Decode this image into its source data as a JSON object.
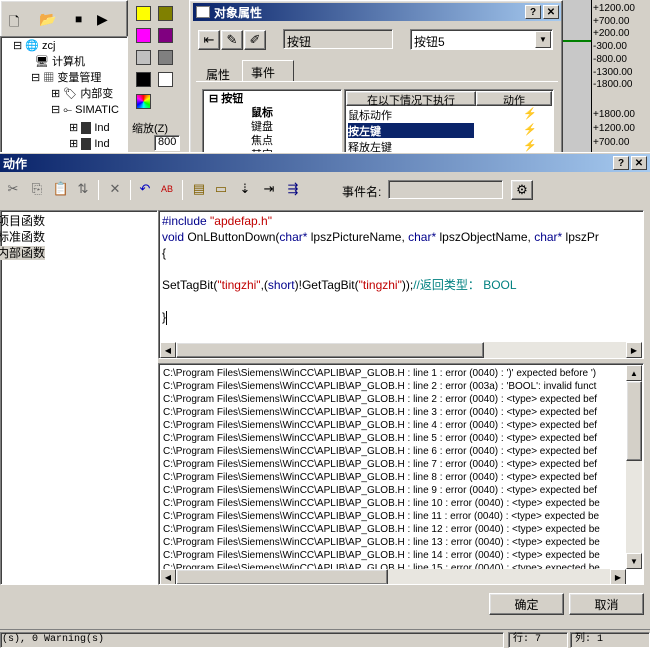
{
  "left_panel": {
    "tree_root": "zcj",
    "tree_items": [
      "计算机",
      "变量管理",
      "内部变",
      "SIMATIC",
      "Ind",
      "Ind"
    ]
  },
  "zoom": {
    "label": "缩放(Z)",
    "value": "800"
  },
  "object_props": {
    "title": "对象属性",
    "object_type": "按钮",
    "object_name": "按钮5",
    "tabs": [
      "属性",
      "事件"
    ],
    "tree": [
      "按钮",
      "鼠标",
      "键盘",
      "焦点",
      "其它"
    ],
    "table_headers": [
      "在以下情况下执行",
      "动作"
    ],
    "rows": [
      "鼠标动作",
      "按左键",
      "释放左键"
    ]
  },
  "right_scale": {
    "top": [
      "+1200.00",
      "+700.00",
      "+200.00",
      "-300.00",
      "-800.00",
      "-1300.00",
      "-1800.00"
    ],
    "bottom": [
      "+1800.00",
      "+1200.00",
      "+700.00"
    ]
  },
  "action_dialog": {
    "title": "动作",
    "event_name_label": "事件名:",
    "event_name_value": "",
    "functions": [
      "项目函数",
      "标准函数",
      "内部函数"
    ],
    "code": {
      "line1_include": "#include",
      "line1_file": "\"apdefap.h\"",
      "line2_void": "void",
      "line2_fn": " OnLButtonDown(",
      "line2_char1": "char*",
      "line2_p1": " lpszPictureName, ",
      "line2_char2": "char*",
      "line2_p2": " lpszObjectName, ",
      "line2_char3": "char*",
      "line2_p3": " lpszPr",
      "line3": "{",
      "line5_a": "SetTagBit(",
      "line5_s1": "\"tingzhi\"",
      "line5_b": ",(",
      "line5_short": "short",
      "line5_c": ")!GetTagBit(",
      "line5_s2": "\"tingzhi\"",
      "line5_d": "));",
      "line5_comment": "//返回类型： BOOL",
      "line7": "}"
    },
    "output": [
      "C:\\Program Files\\Siemens\\WinCC\\APLIB\\AP_GLOB.H : line 1 : error (0040) : ')' expected before ')",
      "C:\\Program Files\\Siemens\\WinCC\\APLIB\\AP_GLOB.H : line 2 : error (003a) : 'BOOL': invalid funct",
      "C:\\Program Files\\Siemens\\WinCC\\APLIB\\AP_GLOB.H : line 2 : error (0040) : <type> expected bef",
      "C:\\Program Files\\Siemens\\WinCC\\APLIB\\AP_GLOB.H : line 3 : error (0040) : <type> expected bef",
      "C:\\Program Files\\Siemens\\WinCC\\APLIB\\AP_GLOB.H : line 4 : error (0040) : <type> expected bef",
      "C:\\Program Files\\Siemens\\WinCC\\APLIB\\AP_GLOB.H : line 5 : error (0040) : <type> expected bef",
      "C:\\Program Files\\Siemens\\WinCC\\APLIB\\AP_GLOB.H : line 6 : error (0040) : <type> expected bef",
      "C:\\Program Files\\Siemens\\WinCC\\APLIB\\AP_GLOB.H : line 7 : error (0040) : <type> expected bef",
      "C:\\Program Files\\Siemens\\WinCC\\APLIB\\AP_GLOB.H : line 8 : error (0040) : <type> expected bef",
      "C:\\Program Files\\Siemens\\WinCC\\APLIB\\AP_GLOB.H : line 9 : error (0040) : <type> expected bef",
      "C:\\Program Files\\Siemens\\WinCC\\APLIB\\AP_GLOB.H : line 10 : error (0040) : <type> expected be",
      "C:\\Program Files\\Siemens\\WinCC\\APLIB\\AP_GLOB.H : line 11 : error (0040) : <type> expected be",
      "C:\\Program Files\\Siemens\\WinCC\\APLIB\\AP_GLOB.H : line 12 : error (0040) : <type> expected be",
      "C:\\Program Files\\Siemens\\WinCC\\APLIB\\AP_GLOB.H : line 13 : error (0040) : <type> expected be",
      "C:\\Program Files\\Siemens\\WinCC\\APLIB\\AP_GLOB.H : line 14 : error (0040) : <type> expected be",
      "C:\\Program Files\\Siemens\\WinCC\\APLIB\\AP_GLOB.H : line 15 : error (0040) : <type> expected be"
    ],
    "ok_label": "确定",
    "cancel_label": "取消"
  },
  "status": {
    "left": "(s), 0 Warning(s)",
    "row": "行: 7",
    "col": "列: 1"
  },
  "colors": {
    "title_active": "#0a246a",
    "title_gradient_end": "#a6caf0",
    "face": "#d4d0c8",
    "selection": "#0a246a"
  }
}
